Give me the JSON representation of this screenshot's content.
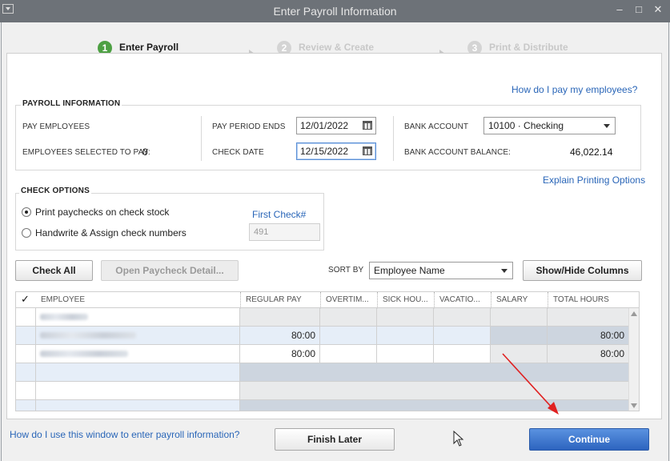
{
  "window": {
    "title": "Enter Payroll Information"
  },
  "steps": [
    {
      "number": "1",
      "label": "Enter Payroll Information"
    },
    {
      "number": "2",
      "label": "Review & Create Paychecks"
    },
    {
      "number": "3",
      "label": "Print & Distribute Paychecks"
    }
  ],
  "links": {
    "help_pay": "How do I pay my employees?",
    "explain_printing": "Explain Printing Options",
    "first_check": "First Check#",
    "footer_help": "How do I use this window to enter payroll information?"
  },
  "payroll_info": {
    "title": "PAYROLL INFORMATION",
    "pay_employees_label": "PAY EMPLOYEES",
    "employees_selected_label": "EMPLOYEES SELECTED TO PAY:",
    "employees_selected_value": "0",
    "pay_period_ends_label": "PAY PERIOD ENDS",
    "pay_period_ends_value": "12/01/2022",
    "check_date_label": "CHECK DATE",
    "check_date_value": "12/15/2022",
    "bank_account_label": "BANK ACCOUNT",
    "bank_account_value": "10100 · Checking",
    "bank_balance_label": "BANK ACCOUNT BALANCE:",
    "bank_balance_value": "46,022.14"
  },
  "check_options": {
    "title": "CHECK OPTIONS",
    "option_print": "Print paychecks on check stock",
    "option_handwrite": "Handwrite & Assign check numbers",
    "first_check_value": "491"
  },
  "toolbar": {
    "check_all": "Check All",
    "open_detail": "Open Paycheck Detail...",
    "sort_by_label": "SORT BY",
    "sort_by_value": "Employee Name",
    "show_hide": "Show/Hide Columns"
  },
  "table": {
    "check_header": "✓",
    "columns": [
      "EMPLOYEE",
      "REGULAR PAY",
      "OVERTIM...",
      "SICK HOU...",
      "VACATIO...",
      "SALARY",
      "TOTAL HOURS"
    ],
    "rows": [
      {
        "regular_pay": "",
        "total_hours": ""
      },
      {
        "regular_pay": "80:00",
        "total_hours": "80:00"
      },
      {
        "regular_pay": "80:00",
        "total_hours": "80:00"
      }
    ]
  },
  "buttons": {
    "finish_later": "Finish Later",
    "continue": "Continue"
  },
  "colors": {
    "accent": "#2d64bf",
    "step_active": "#4da043",
    "link": "#2a66b8",
    "annotation_arrow": "#e02020"
  }
}
